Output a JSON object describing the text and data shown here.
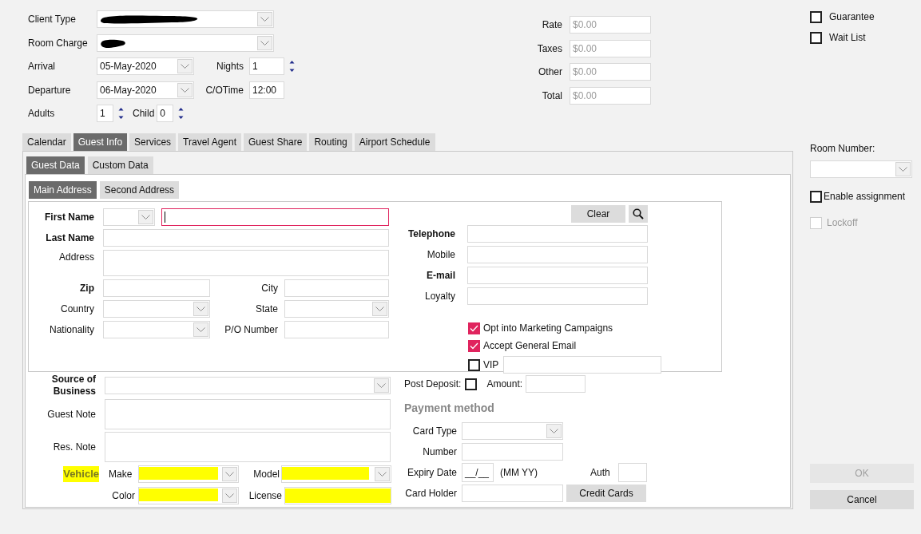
{
  "booking": {
    "client_type": {
      "label": "Client Type",
      "redacted": true
    },
    "room_charge": {
      "label": "Room Charge",
      "redacted": true
    },
    "arrival": {
      "label": "Arrival",
      "value": "05-May-2020"
    },
    "nights": {
      "label": "Nights",
      "value": "1"
    },
    "departure": {
      "label": "Departure",
      "value": "06-May-2020"
    },
    "checkout_time": {
      "label": "C/OTime",
      "value": "12:00"
    },
    "adults": {
      "label": "Adults",
      "value": "1"
    },
    "child": {
      "label": "Child",
      "value": "0"
    }
  },
  "charges": [
    {
      "label": "Rate",
      "value": "$0.00",
      "disabled": true
    },
    {
      "label": "Taxes",
      "value": "$0.00",
      "disabled": true
    },
    {
      "label": "Other",
      "value": "$0.00",
      "disabled": true
    },
    {
      "label": "Total",
      "value": "$0.00",
      "disabled": true
    }
  ],
  "options": [
    {
      "label": "Guarantee",
      "checked": false
    },
    {
      "label": "Wait List",
      "checked": false
    }
  ],
  "tabs": [
    {
      "label": "Calendar",
      "selected": false
    },
    {
      "label": "Guest Info",
      "selected": true
    },
    {
      "label": "Services",
      "selected": false
    },
    {
      "label": "Travel Agent",
      "selected": false
    },
    {
      "label": "Guest Share",
      "selected": false
    },
    {
      "label": "Routing",
      "selected": false
    },
    {
      "label": "Airport Schedule",
      "selected": false
    }
  ],
  "subtabs": [
    {
      "label": "Guest Data",
      "selected": true
    },
    {
      "label": "Custom Data",
      "selected": false
    }
  ],
  "address_tabs": [
    {
      "label": "Main Address",
      "selected": true
    },
    {
      "label": "Second Address",
      "selected": false
    }
  ],
  "address": {
    "first_name": {
      "label": "First Name",
      "bold": true,
      "focused": true
    },
    "last_name": {
      "label": "Last Name",
      "bold": true
    },
    "street": {
      "label": "Address",
      "bold": false
    },
    "location_fields": [
      {
        "label": "Zip",
        "bold": true,
        "kind": "text"
      },
      {
        "label": "City",
        "bold": false,
        "kind": "text"
      },
      {
        "label": "Country",
        "bold": false,
        "kind": "select"
      },
      {
        "label": "State",
        "bold": false,
        "kind": "select"
      },
      {
        "label": "Nationality",
        "bold": false,
        "kind": "select"
      },
      {
        "label": "P/O Number",
        "bold": false,
        "kind": "text"
      }
    ],
    "clear_button": "Clear",
    "contact_fields": [
      {
        "label": "Telephone",
        "bold": true
      },
      {
        "label": "Mobile",
        "bold": false
      },
      {
        "label": "E-mail",
        "bold": true
      },
      {
        "label": "Loyalty",
        "bold": false
      }
    ],
    "consents": [
      {
        "label": "Opt into Marketing Campaigns",
        "checked": true,
        "kind": "check"
      },
      {
        "label": "Accept General Email",
        "checked": true,
        "kind": "check"
      },
      {
        "label": "VIP",
        "checked": false,
        "kind": "check_field"
      }
    ]
  },
  "notes": {
    "source_of_business": "Source of Business",
    "guest_note": "Guest Note",
    "res_note": "Res. Note"
  },
  "vehicle": {
    "label": "Vehicle",
    "highlighted": true,
    "fields": [
      {
        "label": "Make",
        "kind": "select",
        "highlighted": true
      },
      {
        "label": "Model",
        "kind": "select",
        "highlighted": true
      },
      {
        "label": "Color",
        "kind": "select",
        "highlighted": true
      },
      {
        "label": "License",
        "kind": "text",
        "highlighted": true
      }
    ]
  },
  "deposit": {
    "label": "Post Deposit:",
    "checked": false,
    "amount_label": "Amount:"
  },
  "payment": {
    "title": "Payment method",
    "card_type": "Card Type",
    "number": "Number",
    "expiry_label": "Expiry Date",
    "expiry_value": "__/__",
    "expiry_hint": "(MM YY)",
    "auth": "Auth",
    "card_holder": "Card Holder",
    "credit_cards_button": "Credit Cards"
  },
  "room": {
    "label": "Room Number:",
    "enable_assignment": {
      "label": "Enable assignment",
      "checked": false
    },
    "lockoff": {
      "label": "Lockoff",
      "checked": false,
      "disabled": true
    }
  },
  "buttons": [
    {
      "label": "OK",
      "disabled": true
    },
    {
      "label": "Cancel",
      "disabled": false
    }
  ]
}
